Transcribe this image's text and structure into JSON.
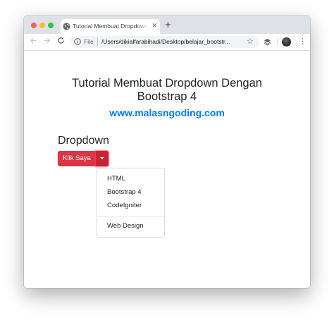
{
  "browser": {
    "tab_title": "Tutorial Membuat Dropdown D",
    "tab_close": "✕",
    "new_tab": "+",
    "address_scheme": "File",
    "address_url": "/Users/dikialfarabihadi/Desktop/belajar_bootstr...",
    "icons": [
      "globe-icon",
      "back-arrow-icon",
      "forward-arrow-icon",
      "reload-icon",
      "info-icon",
      "star-icon",
      "extension-icon",
      "avatar",
      "menu-dots-icon"
    ]
  },
  "page": {
    "heading_line1": "Tutorial Membuat Dropdown Dengan",
    "heading_line2": "Bootstrap 4",
    "site_link": "www.malasngoding.com",
    "section_title": "Dropdown",
    "button_label": "Klik Saya",
    "dropdown_items": [
      "HTML",
      "Bootstrap 4",
      "CodeIgniter"
    ],
    "dropdown_extra_item": "Web Design"
  },
  "colors": {
    "button_red": "#dc3545",
    "toggle_red": "#c82333",
    "link_blue": "#007bff",
    "text_dark": "#212529",
    "tabstrip": "#dee1e6"
  }
}
